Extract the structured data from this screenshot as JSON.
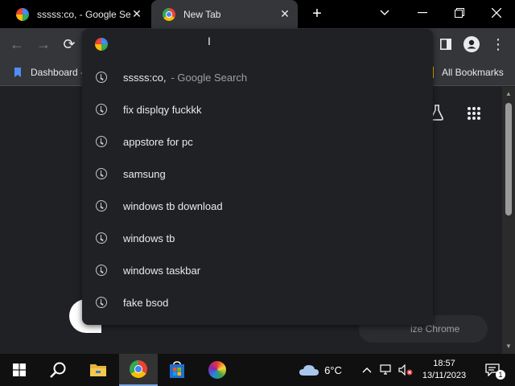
{
  "tabs": [
    {
      "title": "sssss:co, - Google Search",
      "icon": "google-icon"
    },
    {
      "title": "New Tab",
      "icon": "chrome-icon"
    }
  ],
  "omnibox": {
    "input_value": "",
    "suggestions": [
      {
        "text": "sssss:co,",
        "suffix": "- Google Search"
      },
      {
        "text": "fix displqy fuckkk",
        "suffix": ""
      },
      {
        "text": "appstore for pc",
        "suffix": ""
      },
      {
        "text": "samsung",
        "suffix": ""
      },
      {
        "text": "windows tb download",
        "suffix": ""
      },
      {
        "text": "windows tb",
        "suffix": ""
      },
      {
        "text": "windows taskbar",
        "suffix": ""
      },
      {
        "text": "fake bsod",
        "suffix": ""
      }
    ]
  },
  "bookmarks": {
    "item1": "Dashboard -",
    "all": "All Bookmarks"
  },
  "page": {
    "customize_label": "ize Chrome"
  },
  "taskbar": {
    "weather": "6°C",
    "time": "18:57",
    "date": "13/11/2023",
    "notif_count": "1"
  },
  "colors": {
    "bg": "#202124",
    "toolbar": "#35363a",
    "text": "#e8eaed",
    "muted": "#9aa0a6"
  }
}
